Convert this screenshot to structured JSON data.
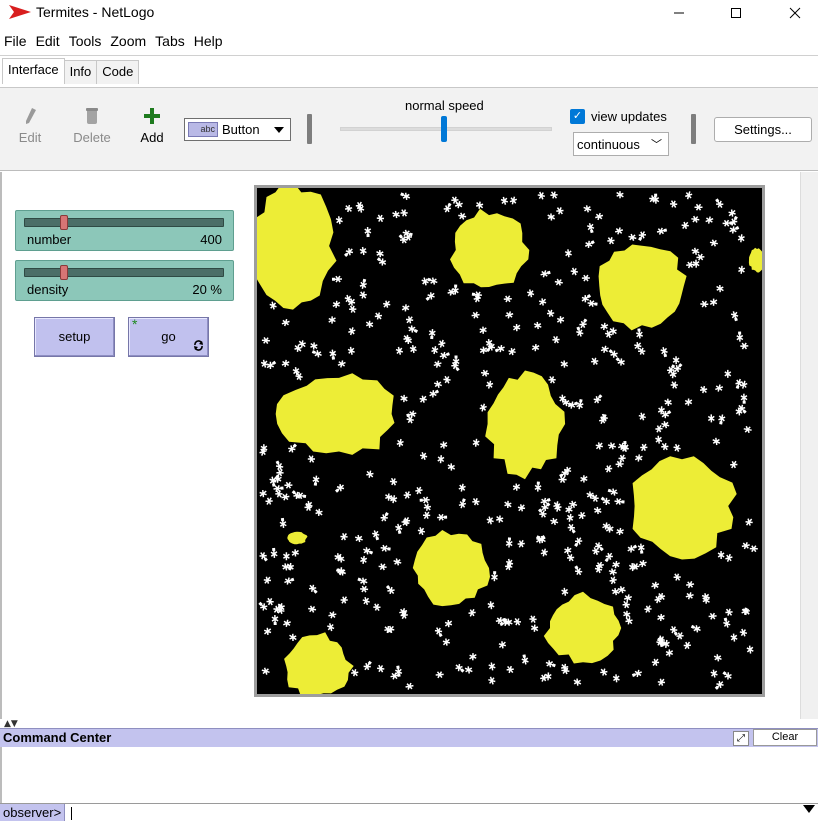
{
  "window": {
    "title": "Termites - NetLogo"
  },
  "menu": [
    "File",
    "Edit",
    "Tools",
    "Zoom",
    "Tabs",
    "Help"
  ],
  "tabs": [
    "Interface",
    "Info",
    "Code"
  ],
  "toolbar": {
    "edit_label": "Edit",
    "delete_label": "Delete",
    "add_label": "Add",
    "widget_type": "Button",
    "widget_icon_text": "abc",
    "speed_label": "normal speed",
    "speed_level": 0.5,
    "view_updates_label": "view updates",
    "view_updates_checked": true,
    "update_mode": "continuous",
    "settings_label": "Settings..."
  },
  "widgets": {
    "number_slider": {
      "name": "number",
      "value": "400",
      "level": 0.2
    },
    "density_slider": {
      "name": "density",
      "value": "20 %",
      "level": 0.2
    },
    "setup_button": {
      "label": "setup"
    },
    "go_button": {
      "label": "go",
      "forever": true
    }
  },
  "world": {
    "background": "#000000",
    "chip_color": "#eded36",
    "termite_color": "#ffffff"
  },
  "command_center": {
    "title": "Command Center",
    "clear_label": "Clear",
    "prompt": "observer>",
    "input_value": ""
  },
  "colors": {
    "slider_bg": "#8cc7b9",
    "button_bg": "#c1c1ee",
    "accent": "#0078d7"
  }
}
